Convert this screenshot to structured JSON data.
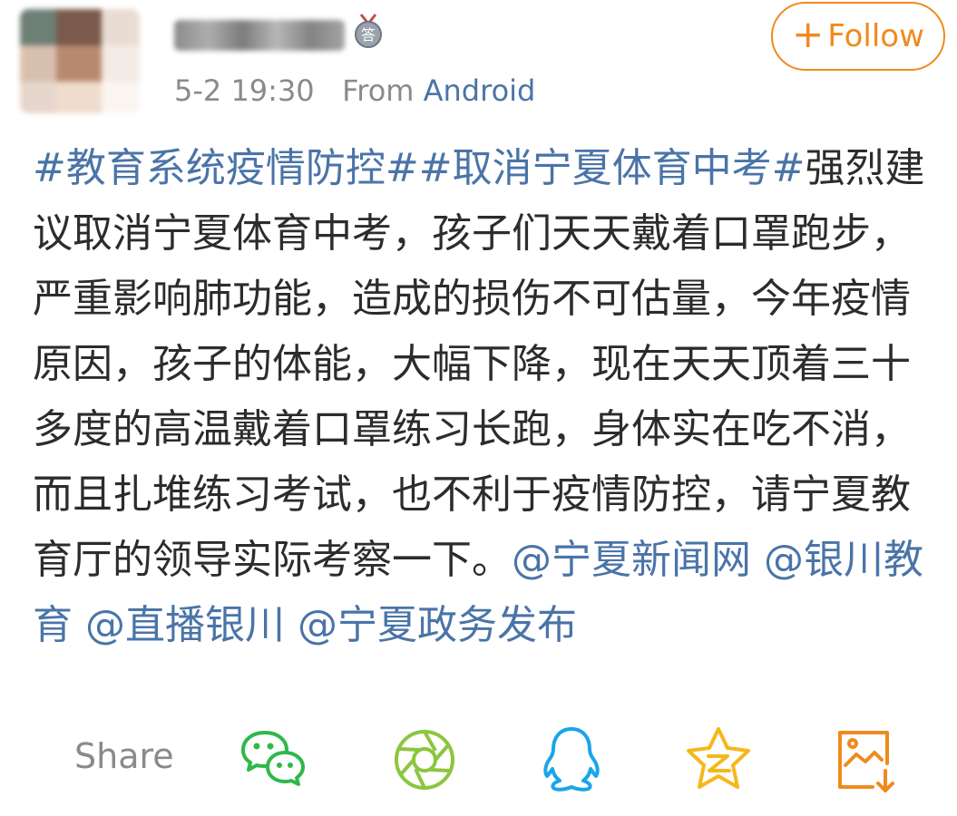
{
  "header": {
    "timestamp": "5-2 19:30",
    "from_label": "From",
    "source": "Android",
    "follow_label": "Follow",
    "follow_plus": "+",
    "medal_char": "答"
  },
  "post": {
    "segments": [
      {
        "text": "#教育系统疫情防控##取消宁夏体育中考#",
        "link": true
      },
      {
        "text": "强烈建议取消宁夏体育中考，孩子们天天戴着口罩跑步，严重影响肺功能，造成的损伤不可估量，今年疫情原因，孩子的体能，大幅下降，现在天天顶着三十多度的高温戴着口罩练习长跑，身体实在吃不消，而且扎堆练习考试，也不利于疫情防控，请宁夏教育厅的领导实际考察一下。",
        "link": false
      },
      {
        "text": "@宁夏新闻网",
        "link": true
      },
      {
        "text": " ",
        "link": false
      },
      {
        "text": "@银川教育",
        "link": true
      },
      {
        "text": " ",
        "link": false
      },
      {
        "text": "@直播银川",
        "link": true
      },
      {
        "text": " ",
        "link": false
      },
      {
        "text": "@宁夏政务发布",
        "link": true
      }
    ]
  },
  "share": {
    "label": "Share",
    "targets": [
      {
        "name": "wechat-icon",
        "color": "#2fb84a"
      },
      {
        "name": "moments-icon",
        "color": "#8cc63f"
      },
      {
        "name": "qq-icon",
        "color": "#1aa5e8"
      },
      {
        "name": "qzone-icon",
        "color": "#f5b81c"
      },
      {
        "name": "save-image-icon",
        "color": "#f08a1e"
      }
    ]
  },
  "colors": {
    "accent": "#f08a1e",
    "link": "#4a74a8",
    "text": "#2c2c2c",
    "muted": "#8a8a8a"
  }
}
